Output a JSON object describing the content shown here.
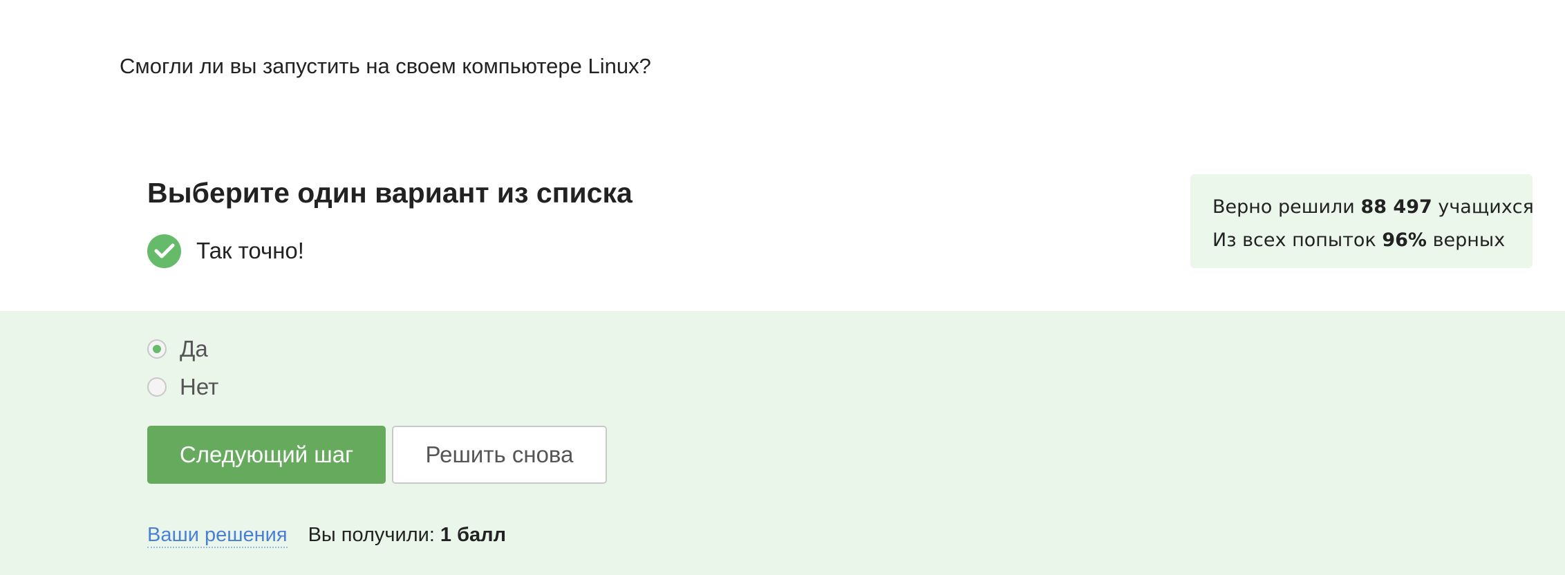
{
  "question": {
    "text": "Смогли ли вы запустить на своем компьютере Linux?"
  },
  "prompt": {
    "title": "Выберите один вариант из списка"
  },
  "feedback": {
    "icon": "check-circle-icon",
    "text": "Так точно!",
    "color": "#66bb6a"
  },
  "stats": {
    "line1_prefix": "Верно решили",
    "line1_value": "88 497",
    "line1_suffix": "учащихся",
    "line2_prefix": "Из всех попыток",
    "line2_value": "96%",
    "line2_suffix": "верных",
    "background": "#ecf7ec"
  },
  "options": [
    {
      "label": "Да",
      "selected": true
    },
    {
      "label": "Нет",
      "selected": false
    }
  ],
  "buttons": {
    "next_label": "Следующий шаг",
    "retry_label": "Решить снова",
    "next_color": "#66aa5d"
  },
  "footer": {
    "solutions_link": "Ваши решения",
    "score_label": "Вы получили:",
    "score_value": "1 балл"
  },
  "colors": {
    "answer_area_background": "#ebf6ea",
    "link": "#4a7fd6"
  }
}
